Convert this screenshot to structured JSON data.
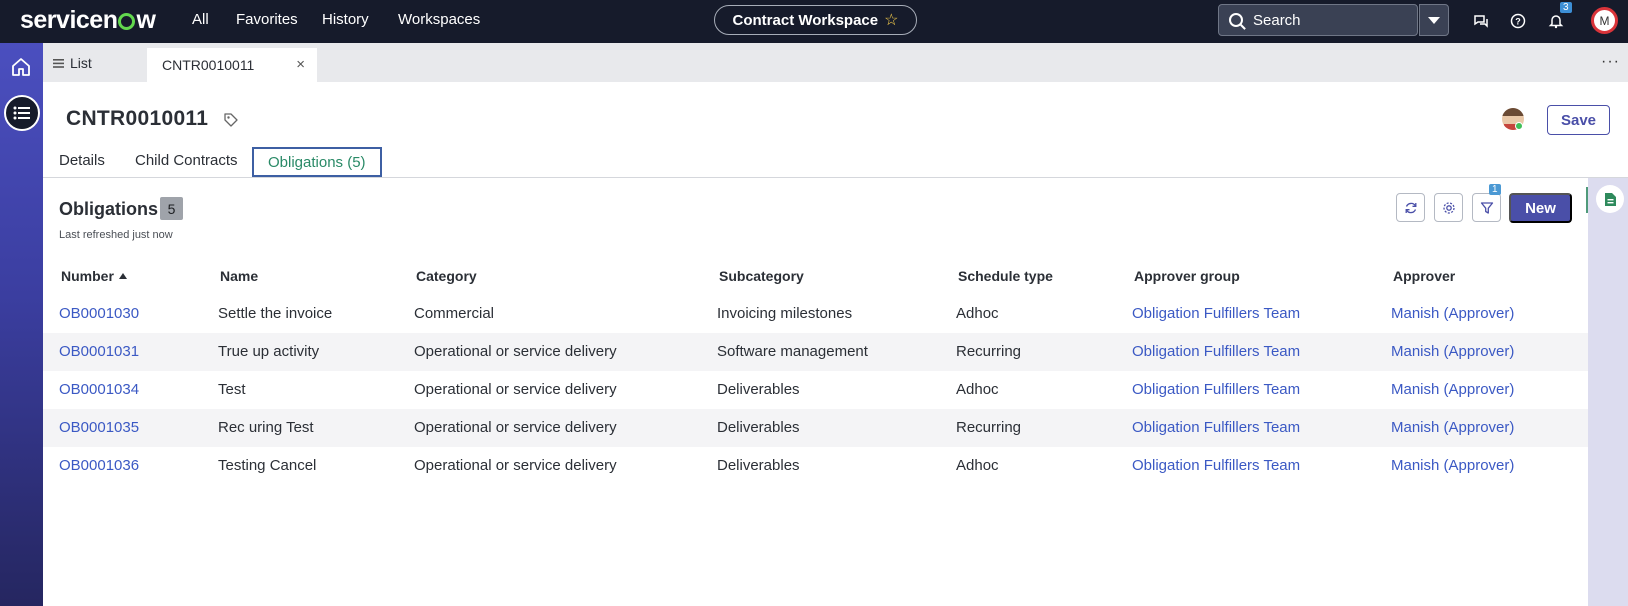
{
  "topbar": {
    "logo": "servicenow",
    "nav": [
      "All",
      "Favorites",
      "History",
      "Workspaces"
    ],
    "workspace": "Contract Workspace",
    "search_placeholder": "Search",
    "notifications_count": "3",
    "user_initial": "M"
  },
  "tabs": {
    "list_label": "List",
    "active_label": "CNTR0010011"
  },
  "record": {
    "title": "CNTR0010011",
    "save_label": "Save",
    "subtabs": [
      "Details",
      "Child Contracts",
      "Obligations (5)"
    ]
  },
  "obligations": {
    "title": "Obligations",
    "count": "5",
    "refreshed": "Last refreshed just now",
    "filter_count": "1",
    "new_label": "New",
    "columns": [
      "Number",
      "Name",
      "Category",
      "Subcategory",
      "Schedule type",
      "Approver group",
      "Approver"
    ],
    "rows": [
      [
        "OB0001030",
        "Settle the invoice",
        "Commercial",
        "Invoicing milestones",
        "Adhoc",
        "Obligation Fulfillers Team",
        "Manish (Approver)"
      ],
      [
        "OB0001031",
        "True up activity",
        "Operational or service delivery",
        "Software management",
        "Recurring",
        "Obligation Fulfillers Team",
        "Manish (Approver)"
      ],
      [
        "OB0001034",
        "Test",
        "Operational or service delivery",
        "Deliverables",
        "Adhoc",
        "Obligation Fulfillers Team",
        "Manish (Approver)"
      ],
      [
        "OB0001035",
        "Rec uring Test",
        "Operational or service delivery",
        "Deliverables",
        "Recurring",
        "Obligation Fulfillers Team",
        "Manish (Approver)"
      ],
      [
        "OB0001036",
        "Testing Cancel",
        "Operational or service delivery",
        "Deliverables",
        "Adhoc",
        "Obligation Fulfillers Team",
        "Manish (Approver)"
      ]
    ]
  },
  "colors": {
    "nav_bg": "#161b2b",
    "accent": "#4a4fa8",
    "link": "#3b59c4",
    "active_tab_text": "#2a8a67"
  }
}
